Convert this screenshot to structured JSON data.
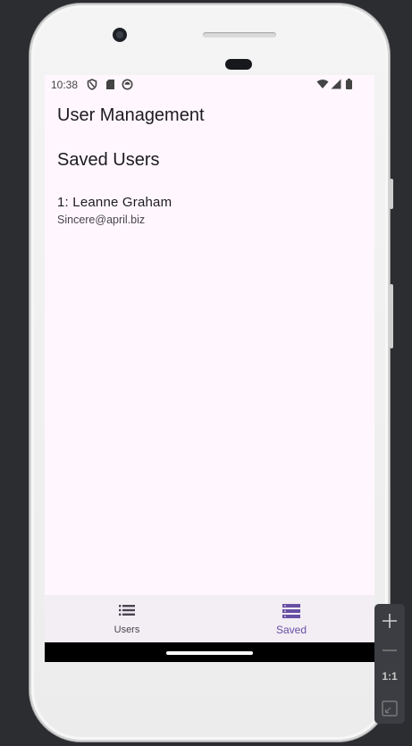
{
  "status_bar": {
    "time": "10:38",
    "left_icons": [
      "shield-icon",
      "sd-card-icon",
      "sync-icon"
    ],
    "right_icons": [
      "wifi-icon",
      "signal-icon",
      "battery-icon"
    ]
  },
  "app": {
    "title": "User Management",
    "section_title": "Saved Users",
    "saved_users": [
      {
        "name": "1: Leanne Graham",
        "email": "Sincere@april.biz"
      }
    ]
  },
  "bottom_nav": {
    "items": [
      {
        "label": "Users",
        "icon": "list-icon",
        "active": false
      },
      {
        "label": "Saved",
        "icon": "saved-list-icon",
        "active": true
      }
    ],
    "active_color": "#6750a4",
    "inactive_color": "#49454f"
  },
  "emulator_zoom": {
    "actual_size_label": "1:1"
  },
  "colors": {
    "screen_background": "#fff7fd",
    "nav_background": "#f3edf4",
    "accent": "#6750a4"
  }
}
